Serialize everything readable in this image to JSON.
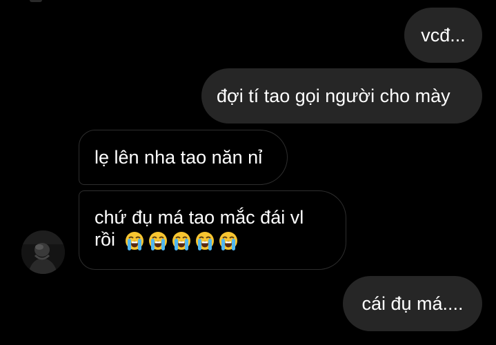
{
  "messages": [
    {
      "side": "out",
      "text": "vcđ..."
    },
    {
      "side": "out",
      "text": "đợi tí tao gọi người cho mày"
    },
    {
      "side": "in",
      "text": "lẹ lên nha tao năn nỉ"
    },
    {
      "side": "in",
      "line1": "chứ đụ má tao mắc đái vl",
      "line2": "rồi",
      "emoji": "loudly-crying-face",
      "emoji_count": 5
    },
    {
      "side": "out",
      "text": "cái đụ má...."
    }
  ],
  "colors": {
    "background": "#000000",
    "outgoing_bubble": "#262626",
    "incoming_border": "#2e2e2e",
    "text": "#ffffff",
    "emoji_face": "#f7c531",
    "emoji_tears": "#4fb6f0"
  }
}
